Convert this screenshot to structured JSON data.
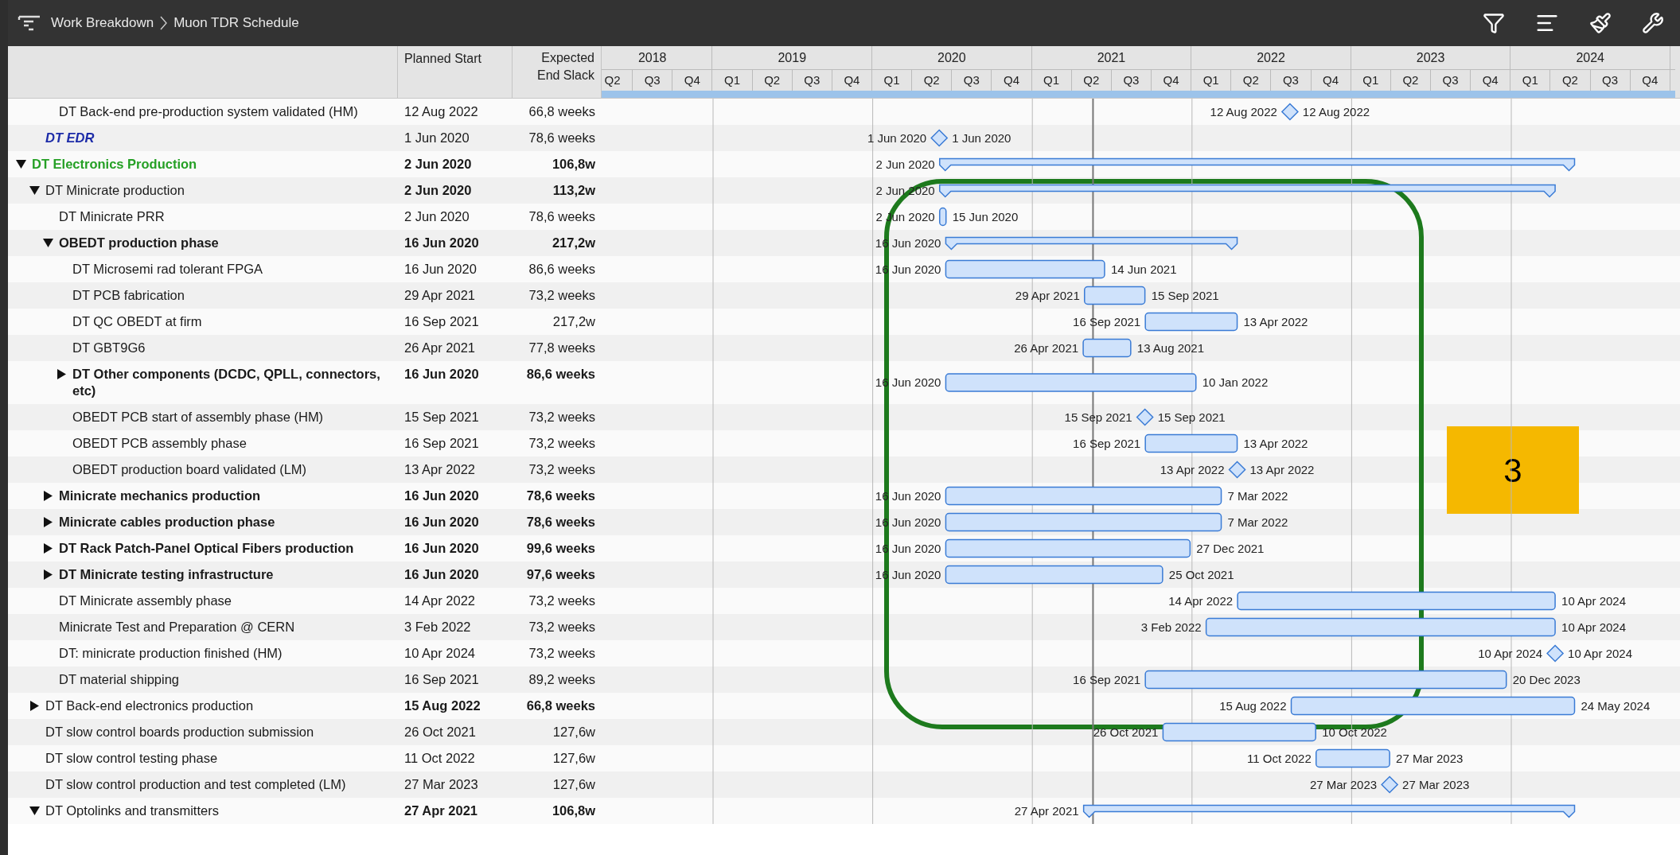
{
  "breadcrumb": [
    "Work Breakdown",
    "Muon TDR Schedule"
  ],
  "columns": {
    "planned_start": "Planned Start",
    "slack": "Expected End Slack"
  },
  "timeline": [
    {
      "label": "2018",
      "quarters": [
        "Q2",
        "Q3",
        "Q4"
      ]
    },
    {
      "label": "2019",
      "quarters": [
        "Q1",
        "Q2",
        "Q3",
        "Q4"
      ]
    },
    {
      "label": "2020",
      "quarters": [
        "Q1",
        "Q2",
        "Q3",
        "Q4"
      ]
    },
    {
      "label": "2021",
      "quarters": [
        "Q1",
        "Q2",
        "Q3",
        "Q4"
      ]
    },
    {
      "label": "2022",
      "quarters": [
        "Q1",
        "Q2",
        "Q3",
        "Q4"
      ]
    },
    {
      "label": "2023",
      "quarters": [
        "Q1",
        "Q2",
        "Q3",
        "Q4"
      ]
    },
    {
      "label": "2024",
      "quarters": [
        "Q1",
        "Q2",
        "Q3",
        "Q4"
      ]
    }
  ],
  "rows": [
    {
      "children": [
        {
          "children": [
            {
              "name": "DT Back-end pre-production system validated (HM)",
              "bold": false,
              "italic": false,
              "planned_start": "12 Aug 2022",
              "slack": "66,8 weeks",
              "gantt": {
                "kind": "milestone",
                "start_label": "12 Aug 2022",
                "end_label": "12 Aug 2022"
              }
            }
          ]
        },
        {
          "name": "DT EDR",
          "bold": true,
          "italic": true,
          "color": "#1c2ba8",
          "planned_start": "1 Jun 2020",
          "slack": "78,6 weeks",
          "gantt": {
            "kind": "milestone",
            "start_label": "1 Jun 2020",
            "end_label": "1 Jun 2020"
          }
        }
      ]
    },
    {
      "name": "DT Electronics Production",
      "bold": true,
      "italic": false,
      "color": "#25a025",
      "expanded": true,
      "planned_start": "2 Jun 2020",
      "slack": "106,8w",
      "gantt": {
        "kind": "summary",
        "start_label": "2 Jun 2020"
      },
      "children": [
        {
          "name": "DT Minicrate production",
          "bold": false,
          "italic": false,
          "expanded": true,
          "planned_start": "2 Jun 2020",
          "slack": "113,2w",
          "gantt": {
            "kind": "summary",
            "start_label": "2 Jun 2020"
          },
          "children": [
            {
              "name": "DT Minicrate PRR",
              "bold": false,
              "italic": false,
              "planned_start": "2 Jun 2020",
              "slack": "78,6 weeks",
              "gantt": {
                "kind": "bar",
                "start_label": "2 Jun 2020",
                "end_label": "15 Jun 2020"
              }
            },
            {
              "name": "OBEDT production phase",
              "bold": true,
              "italic": false,
              "expanded": true,
              "planned_start": "16 Jun 2020",
              "slack": "217,2w",
              "gantt": {
                "kind": "summary",
                "start_label": "16 Jun 2020"
              },
              "children": [
                {
                  "name": "DT Microsemi rad tolerant FPGA",
                  "bold": false,
                  "italic": false,
                  "planned_start": "16 Jun 2020",
                  "slack": "86,6 weeks",
                  "gantt": {
                    "kind": "bar",
                    "start_label": "16 Jun 2020",
                    "end_label": "14 Jun 2021"
                  }
                },
                {
                  "name": "DT PCB fabrication",
                  "bold": false,
                  "italic": false,
                  "planned_start": "29 Apr 2021",
                  "slack": "73,2 weeks",
                  "gantt": {
                    "kind": "bar",
                    "start_label": "29 Apr 2021",
                    "end_label": "15 Sep 2021"
                  }
                },
                {
                  "name": "DT QC OBEDT at firm",
                  "bold": false,
                  "italic": false,
                  "planned_start": "16 Sep 2021",
                  "slack": "217,2w",
                  "gantt": {
                    "kind": "bar",
                    "start_label": "16 Sep 2021",
                    "end_label": "13 Apr 2022"
                  }
                },
                {
                  "name": "DT GBT9G6",
                  "bold": false,
                  "italic": false,
                  "planned_start": "26 Apr 2021",
                  "slack": "77,8 weeks",
                  "gantt": {
                    "kind": "bar",
                    "start_label": "26 Apr 2021",
                    "end_label": "13 Aug 2021"
                  }
                },
                {
                  "name": "DT Other components (DCDC, QPLL, connectors, etc)",
                  "bold": true,
                  "italic": false,
                  "expanded": false,
                  "planned_start": "16 Jun 2020",
                  "slack": "86,6 weeks",
                  "gantt": {
                    "kind": "bar",
                    "start_label": "16 Jun 2020",
                    "end_label": "10 Jan 2022"
                  }
                },
                {
                  "name": "OBEDT PCB start of assembly phase (HM)",
                  "bold": false,
                  "italic": false,
                  "planned_start": "15 Sep 2021",
                  "slack": "73,2 weeks",
                  "gantt": {
                    "kind": "milestone",
                    "start_label": "15 Sep 2021",
                    "end_label": "15 Sep 2021"
                  }
                },
                {
                  "name": "OBEDT PCB assembly phase",
                  "bold": false,
                  "italic": false,
                  "planned_start": "16 Sep 2021",
                  "slack": "73,2 weeks",
                  "gantt": {
                    "kind": "bar",
                    "start_label": "16 Sep 2021",
                    "end_label": "13 Apr 2022"
                  }
                },
                {
                  "name": "OBEDT production board validated (LM)",
                  "bold": false,
                  "italic": false,
                  "planned_start": "13 Apr 2022",
                  "slack": "73,2 weeks",
                  "gantt": {
                    "kind": "milestone",
                    "start_label": "13 Apr 2022",
                    "end_label": "13 Apr 2022"
                  }
                }
              ]
            },
            {
              "name": "Minicrate mechanics production",
              "bold": true,
              "italic": false,
              "expanded": false,
              "planned_start": "16 Jun 2020",
              "slack": "78,6 weeks",
              "gantt": {
                "kind": "bar",
                "start_label": "16 Jun 2020",
                "end_label": "7 Mar 2022"
              }
            },
            {
              "name": "Minicrate cables production phase",
              "bold": true,
              "italic": false,
              "expanded": false,
              "planned_start": "16 Jun 2020",
              "slack": "78,6 weeks",
              "gantt": {
                "kind": "bar",
                "start_label": "16 Jun 2020",
                "end_label": "7 Mar 2022"
              }
            },
            {
              "name": "DT Rack Patch-Panel Optical Fibers production",
              "bold": true,
              "italic": false,
              "expanded": false,
              "planned_start": "16 Jun 2020",
              "slack": "99,6 weeks",
              "gantt": {
                "kind": "bar",
                "start_label": "16 Jun 2020",
                "end_label": "27 Dec 2021"
              }
            },
            {
              "name": "DT Minicrate testing infrastructure",
              "bold": true,
              "italic": false,
              "expanded": false,
              "planned_start": "16 Jun 2020",
              "slack": "97,6 weeks",
              "gantt": {
                "kind": "bar",
                "start_label": "16 Jun 2020",
                "end_label": "25 Oct 2021"
              }
            },
            {
              "name": "DT Minicrate assembly phase",
              "bold": false,
              "italic": false,
              "planned_start": "14 Apr 2022",
              "slack": "73,2 weeks",
              "gantt": {
                "kind": "bar",
                "start_label": "14 Apr 2022",
                "end_label": "10 Apr 2024"
              }
            },
            {
              "name": "Minicrate Test and Preparation @ CERN",
              "bold": false,
              "italic": false,
              "planned_start": "3 Feb 2022",
              "slack": "73,2 weeks",
              "gantt": {
                "kind": "bar",
                "start_label": "3 Feb 2022",
                "end_label": "10 Apr 2024"
              }
            },
            {
              "name": "DT: minicrate production finished (HM)",
              "bold": false,
              "italic": false,
              "planned_start": "10 Apr 2024",
              "slack": "73,2 weeks",
              "gantt": {
                "kind": "milestone",
                "start_label": "10 Apr 2024",
                "end_label": "10 Apr 2024"
              }
            },
            {
              "name": "DT material shipping",
              "bold": false,
              "italic": false,
              "planned_start": "16 Sep 2021",
              "slack": "89,2 weeks",
              "gantt": {
                "kind": "bar",
                "start_label": "16 Sep 2021",
                "end_label": "20 Dec 2023"
              }
            }
          ]
        },
        {
          "name": "DT Back-end electronics production",
          "bold": false,
          "italic": false,
          "expanded": false,
          "planned_start": "15 Aug 2022",
          "slack": "66,8 weeks",
          "gantt": {
            "kind": "bar",
            "start_label": "15 Aug 2022",
            "end_label": "24 May 2024"
          }
        },
        {
          "name": "DT slow control boards production submission",
          "bold": false,
          "italic": false,
          "planned_start": "26 Oct 2021",
          "slack": "127,6w",
          "gantt": {
            "kind": "bar",
            "start_label": "26 Oct 2021",
            "end_label": "10 Oct 2022"
          }
        },
        {
          "name": "DT slow control testing phase",
          "bold": false,
          "italic": false,
          "planned_start": "11 Oct 2022",
          "slack": "127,6w",
          "gantt": {
            "kind": "bar",
            "start_label": "11 Oct 2022",
            "end_label": "27 Mar 2023"
          }
        },
        {
          "name": "DT slow control production and test completed (LM)",
          "bold": false,
          "italic": false,
          "planned_start": "27 Mar 2023",
          "slack": "127,6w",
          "gantt": {
            "kind": "milestone",
            "start_label": "27 Mar 2023",
            "end_label": "27 Mar 2023"
          }
        },
        {
          "name": "DT Optolinks and transmitters",
          "bold": false,
          "italic": false,
          "expanded": true,
          "planned_start": "27 Apr 2021",
          "slack": "106,8w",
          "gantt": {
            "kind": "summary",
            "start_label": "27 Apr 2021"
          }
        }
      ]
    }
  ],
  "annotation": {
    "label": "3"
  }
}
